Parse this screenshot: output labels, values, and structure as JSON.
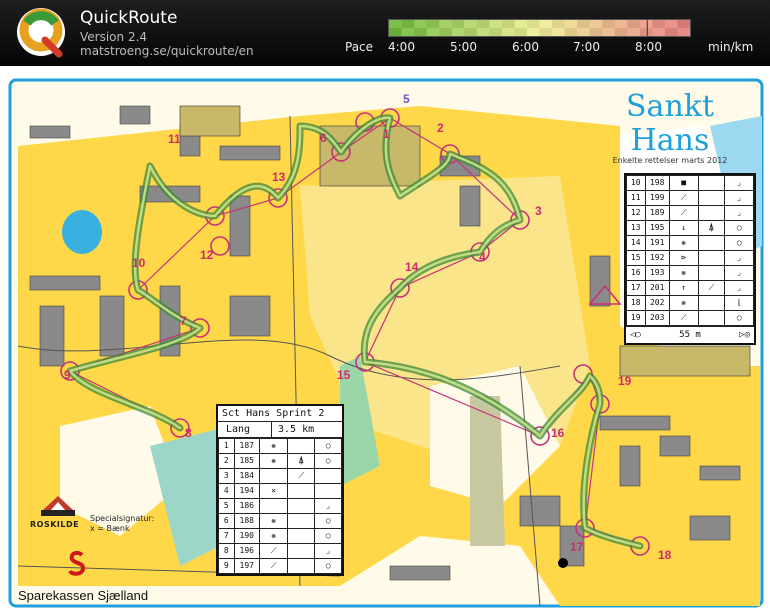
{
  "app": {
    "title": "QuickRoute",
    "version": "Version 2.4",
    "url": "matstroeng.se/quickroute/en"
  },
  "pace": {
    "label": "Pace",
    "unit": "min/km",
    "ticks": [
      "4:00",
      "5:00",
      "6:00",
      "7:00",
      "8:00"
    ],
    "colors": {
      "fast": "#7cc04a",
      "mid": "#f2f2a0",
      "slow": "#e98a8a"
    }
  },
  "map": {
    "title": "Sankt Hans",
    "subtitle": "Enkelte rettelser marts 2012",
    "scale": "1:4000",
    "route_color": "#3f8a3a",
    "course_color": "#c8327a"
  },
  "description_small": {
    "rows": [
      [
        "10",
        "198",
        "■",
        "",
        "⌟"
      ],
      [
        "11",
        "199",
        "⟋",
        "",
        "⌟"
      ],
      [
        "12",
        "189",
        "⟋",
        "",
        "⌟"
      ],
      [
        "13",
        "195",
        "↓",
        "⍋",
        "○"
      ],
      [
        "14",
        "191",
        "❋",
        "",
        "○"
      ],
      [
        "15",
        "192",
        "⊳",
        "",
        "⌟"
      ],
      [
        "16",
        "193",
        "❋",
        "",
        "⌟"
      ],
      [
        "17",
        "201",
        "↑",
        "⟋",
        "⌟"
      ],
      [
        "18",
        "202",
        "❋",
        "",
        "⌊"
      ],
      [
        "19",
        "203",
        "⟋",
        "",
        "○"
      ]
    ],
    "footer": "55 m"
  },
  "description_main": {
    "title": "Sct Hans Sprint 2",
    "class": "Lang",
    "distance": "3.5 km",
    "rows": [
      [
        "1",
        "187",
        "❋",
        "",
        "○"
      ],
      [
        "2",
        "185",
        "❋",
        "⍋",
        "○"
      ],
      [
        "3",
        "184",
        "",
        "⟋",
        ""
      ],
      [
        "4",
        "194",
        "✕",
        "",
        ""
      ],
      [
        "5",
        "186",
        "",
        "",
        "⌟"
      ],
      [
        "6",
        "188",
        "❋",
        "",
        "○"
      ],
      [
        "7",
        "190",
        "❋",
        "",
        "○"
      ],
      [
        "8",
        "196",
        "⟋",
        "",
        "⌟"
      ],
      [
        "9",
        "197",
        "⟋",
        "",
        "○"
      ]
    ]
  },
  "controls": [
    "1",
    "2",
    "3",
    "4",
    "5",
    "6",
    "7",
    "8",
    "9",
    "10",
    "11",
    "12",
    "13",
    "14",
    "15",
    "16",
    "17",
    "18",
    "19"
  ],
  "logos": {
    "club": "ROSKILDE",
    "special": "Specialsignatur:\nx = Bænk",
    "bank": "Sparekassen Sjælland"
  }
}
